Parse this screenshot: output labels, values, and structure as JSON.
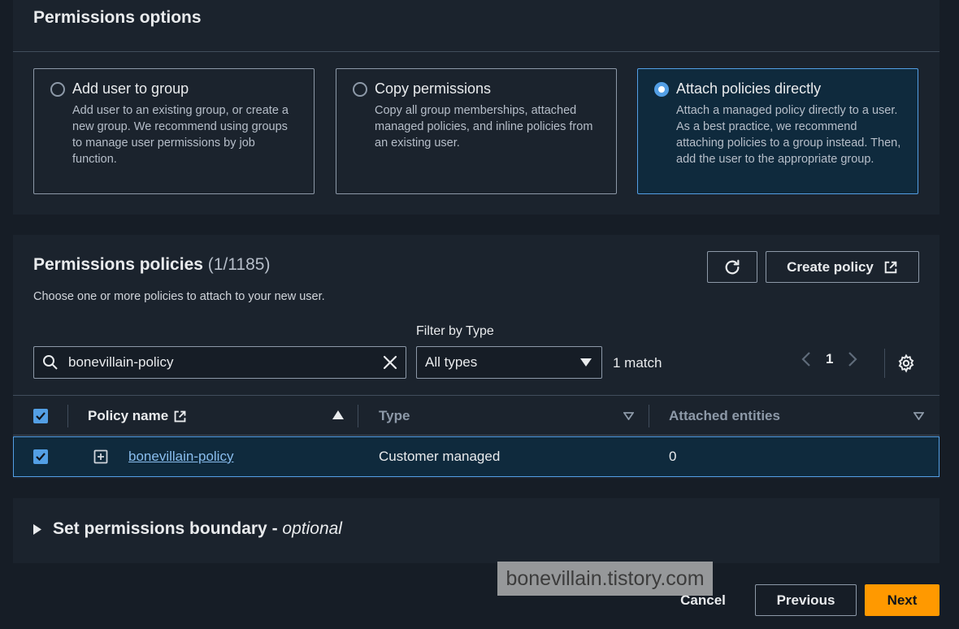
{
  "permissions_options": {
    "title": "Permissions options",
    "options": [
      {
        "label": "Add user to group",
        "desc": "Add user to an existing group, or create a new group. We recommend using groups to manage user permissions by job function.",
        "selected": false
      },
      {
        "label": "Copy permissions",
        "desc": "Copy all group memberships, attached managed policies, and inline policies from an existing user.",
        "selected": false
      },
      {
        "label": "Attach policies directly",
        "desc": "Attach a managed policy directly to a user. As a best practice, we recommend attaching policies to a group instead. Then, add the user to the appropriate group.",
        "selected": true
      }
    ]
  },
  "policies": {
    "title": "Permissions policies",
    "count": "(1/1185)",
    "subtitle": "Choose one or more policies to attach to your new user.",
    "create_label": "Create policy",
    "search_value": "bonevillain-policy",
    "filter_label": "Filter by Type",
    "filter_value": "All types",
    "match_text": "1 match",
    "page": "1",
    "columns": {
      "name": "Policy name",
      "type": "Type",
      "entities": "Attached entities"
    },
    "rows": [
      {
        "name": "bonevillain-policy",
        "type": "Customer managed",
        "entities": "0",
        "checked": true
      }
    ]
  },
  "boundary": {
    "title": "Set permissions boundary - ",
    "optional": "optional"
  },
  "watermark": "bonevillain.tistory.com",
  "footer": {
    "cancel": "Cancel",
    "previous": "Previous",
    "next": "Next"
  },
  "colors": {
    "accent": "#539fe5",
    "primary_button": "#ff9900",
    "link": "#89bdee"
  }
}
